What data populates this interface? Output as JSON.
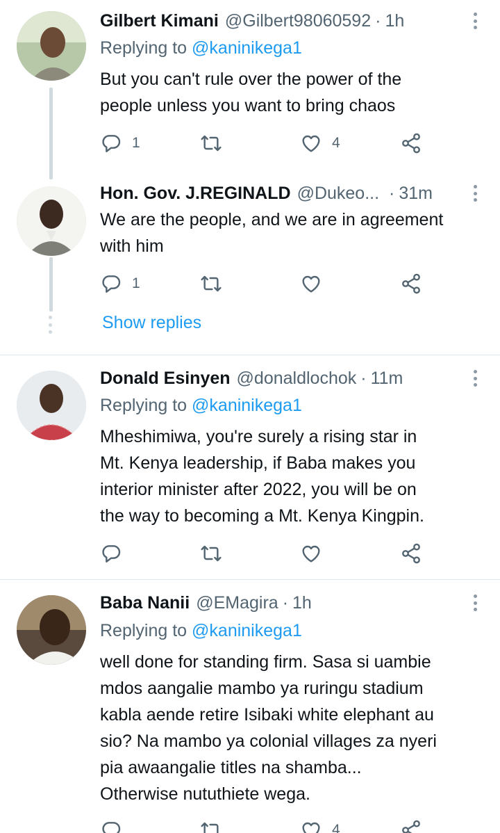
{
  "tweets": [
    {
      "name": "Gilbert Kimani",
      "handle": "@Gilbert98060592",
      "time": "1h",
      "replying_prefix": "Replying to ",
      "replying_to": "@kaninikega1",
      "lines": [
        "But you can't rule over the power of the",
        "people unless you want to bring chaos"
      ],
      "reply_count": "1",
      "retweet_count": "",
      "like_count": "4"
    },
    {
      "name": "Hon. Gov. J.REGINALD",
      "handle": "@Dukeo...",
      "time": "31m",
      "lines": [
        "We are the people, and we are in agreement",
        "with him"
      ],
      "reply_count": "1",
      "retweet_count": "",
      "like_count": ""
    },
    {
      "name": "Donald Esinyen",
      "handle": "@donaldlochok",
      "time": "11m",
      "replying_prefix": "Replying to ",
      "replying_to": "@kaninikega1",
      "lines": [
        "Mheshimiwa, you're surely a rising star in",
        "Mt. Kenya leadership, if Baba makes you",
        "interior minister after 2022, you will be on",
        "the way to becoming a Mt. Kenya Kingpin."
      ],
      "reply_count": "",
      "retweet_count": "",
      "like_count": ""
    },
    {
      "name": "Baba Nanii",
      "handle": "@EMagira",
      "time": "1h",
      "replying_prefix": "Replying to ",
      "replying_to": "@kaninikega1",
      "lines": [
        "well done for standing firm. Sasa si uambie",
        "mdos aangalie mambo ya ruringu stadium",
        "kabla aende retire Isibaki white elephant au",
        "sio? Na mambo ya colonial villages za nyeri",
        "pia awaangalie titles na shamba...",
        "Otherwise nututhiete wega."
      ],
      "reply_count": "",
      "retweet_count": "",
      "like_count": "4"
    }
  ],
  "separator": "·",
  "show_replies_label": "Show replies",
  "icons": {
    "reply": "reply-icon",
    "retweet": "retweet-icon",
    "like": "heart-icon",
    "share": "share-icon",
    "more": "more-vertical-icon"
  },
  "colors": {
    "accent": "#1d9bf0",
    "secondary_text": "#536471",
    "primary_text": "#0f1419"
  }
}
